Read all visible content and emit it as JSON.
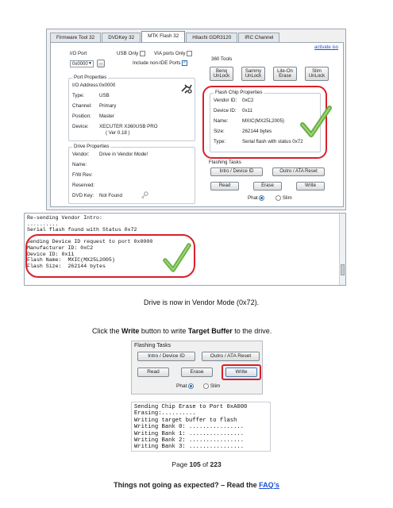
{
  "tabs": [
    "Firmware Tool 32",
    "DVDKey 32",
    "MTK Flash 32",
    "Hitachi GDR3120",
    "IRC Channel"
  ],
  "activate_link": "activate iso",
  "io_port": {
    "label": "I/O Port",
    "value": "0x0000",
    "browse": "...",
    "usb_only": "USB Only",
    "via_ports_only": "VIA ports Only",
    "include_non_ide": "Include non-IDE Ports"
  },
  "port_properties": {
    "title": "Port Properties",
    "rows": [
      {
        "k": "I/O Address:",
        "v": "0x0000"
      },
      {
        "k": "Type:",
        "v": "USB"
      },
      {
        "k": "Channel:",
        "v": "Primary"
      },
      {
        "k": "Position:",
        "v": "Master"
      },
      {
        "k": "Device:",
        "v": "XECUTER X360USB PRO"
      }
    ],
    "device_version": "( Ver 0.18 )"
  },
  "drive_properties": {
    "title": "Drive Properties",
    "rows": [
      {
        "k": "Vendor:",
        "v": "Drive in Vendor Mode!"
      },
      {
        "k": "Name:",
        "v": ""
      },
      {
        "k": "F/W Rev:",
        "v": ""
      },
      {
        "k": "Reserved:",
        "v": ""
      },
      {
        "k": "DVD Key:",
        "v": "Not Found"
      }
    ]
  },
  "tools_360": {
    "title": "360 Tools",
    "buttons": [
      "Benq UnLock",
      "Sammy UnLock",
      "Lite-On Erase",
      "Slim UnLock"
    ]
  },
  "flash_chip": {
    "title": "Flash Chip Properties",
    "rows": [
      {
        "k": "Vendor ID:",
        "v": "0xC2"
      },
      {
        "k": "Device ID:",
        "v": "0x11"
      },
      {
        "k": "Name:",
        "v": "MXIC(MX25L2005)"
      },
      {
        "k": "Size:",
        "v": "262144 bytes"
      },
      {
        "k": "Type:",
        "v": "Serial flash with status 0x72"
      }
    ]
  },
  "flashing_tasks": {
    "title": "Flashing Tasks",
    "intro": "Intro / Device ID",
    "outro": "Outro / ATA Reset",
    "read": "Read",
    "erase": "Erase",
    "write": "Write",
    "phat": "Phat",
    "slim": "Slim"
  },
  "log1": "Re-sending Vendor Intro:\n..........\nSerial flash found with Status 0x72\n\nSending Device ID request to port 0x0000\nManufacturer ID: 0xC2\nDevice ID: 0x11\nFlash Name:  MXIC(MX25L2005)\nFlash Size:  262144 bytes",
  "caption1": "Drive is now in Vendor Mode (0x72).",
  "instruction": {
    "pre": "Click the ",
    "b1": "Write",
    "mid": " button to write ",
    "b2": "Target Buffer",
    "post": " to the drive."
  },
  "log2": "Sending Chip Erase to Port 0xA000\nErasing:..........\nWriting target buffer to flash\nWriting Bank 0: ................\nWriting Bank 1: ................\nWriting Bank 2: ................\nWriting Bank 3: ................",
  "footer": {
    "page_pre": "Page ",
    "page": "105",
    "page_mid": " of ",
    "total": "223",
    "faq_pre": "Things not going as expected? – Read the ",
    "faq_link": "FAQ’s"
  }
}
